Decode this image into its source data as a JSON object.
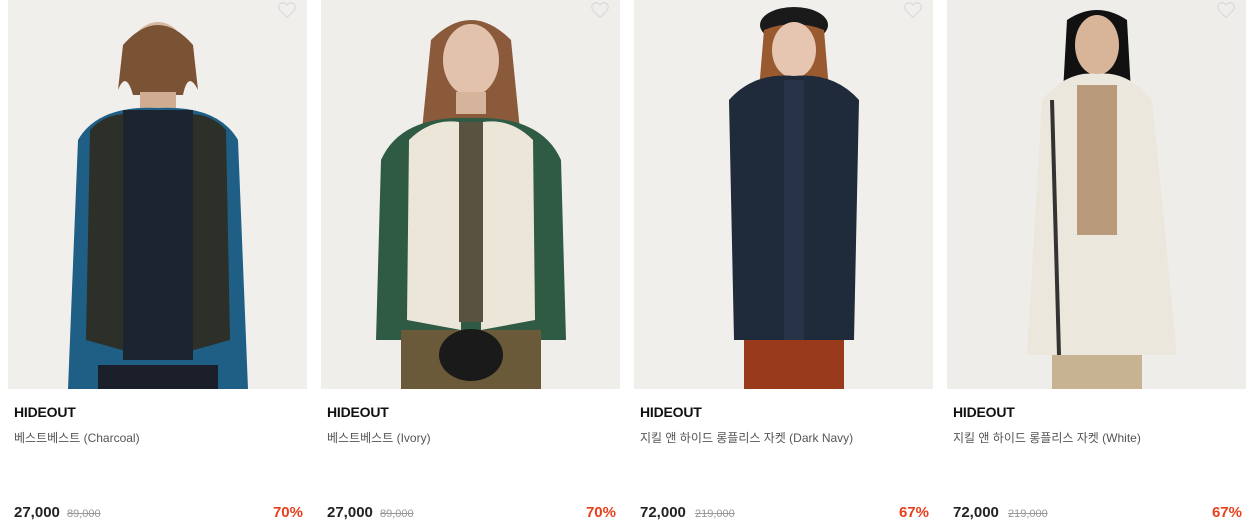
{
  "products": [
    {
      "brand": "HIDEOUT",
      "name": "베스트베스트 (Charcoal)",
      "price": "27,000",
      "original_price": "89,000",
      "discount": "70%",
      "image_icon": "model-photo",
      "wishlist_icon": "heart-outline-icon",
      "bg_color": "#f1efec",
      "garment_color": "#2c3028",
      "inner_color": "#1f5f86"
    },
    {
      "brand": "HIDEOUT",
      "name": "베스트베스트 (Ivory)",
      "price": "27,000",
      "original_price": "89,000",
      "discount": "70%",
      "image_icon": "model-photo",
      "wishlist_icon": "heart-outline-icon",
      "bg_color": "#f0eeea",
      "garment_color": "#ece6d8",
      "inner_color": "#2f5a44"
    },
    {
      "brand": "HIDEOUT",
      "name": "지킬 앤 하이드 롱플리스 자켓 (Dark Navy)",
      "price": "72,000",
      "original_price": "219,000",
      "discount": "67%",
      "image_icon": "model-photo",
      "wishlist_icon": "heart-outline-icon",
      "bg_color": "#f1efec",
      "garment_color": "#1f2a3a",
      "inner_color": "#9a3a1c"
    },
    {
      "brand": "HIDEOUT",
      "name": "지킬 앤 하이드 롱플리스 자켓 (White)",
      "price": "72,000",
      "original_price": "219,000",
      "discount": "67%",
      "image_icon": "model-photo",
      "wishlist_icon": "heart-outline-icon",
      "bg_color": "#efedea",
      "garment_color": "#ece7dc",
      "inner_color": "#b89a7a"
    }
  ],
  "colors": {
    "discount": "#e8401c",
    "price": "#222222",
    "original_price": "#999999"
  }
}
